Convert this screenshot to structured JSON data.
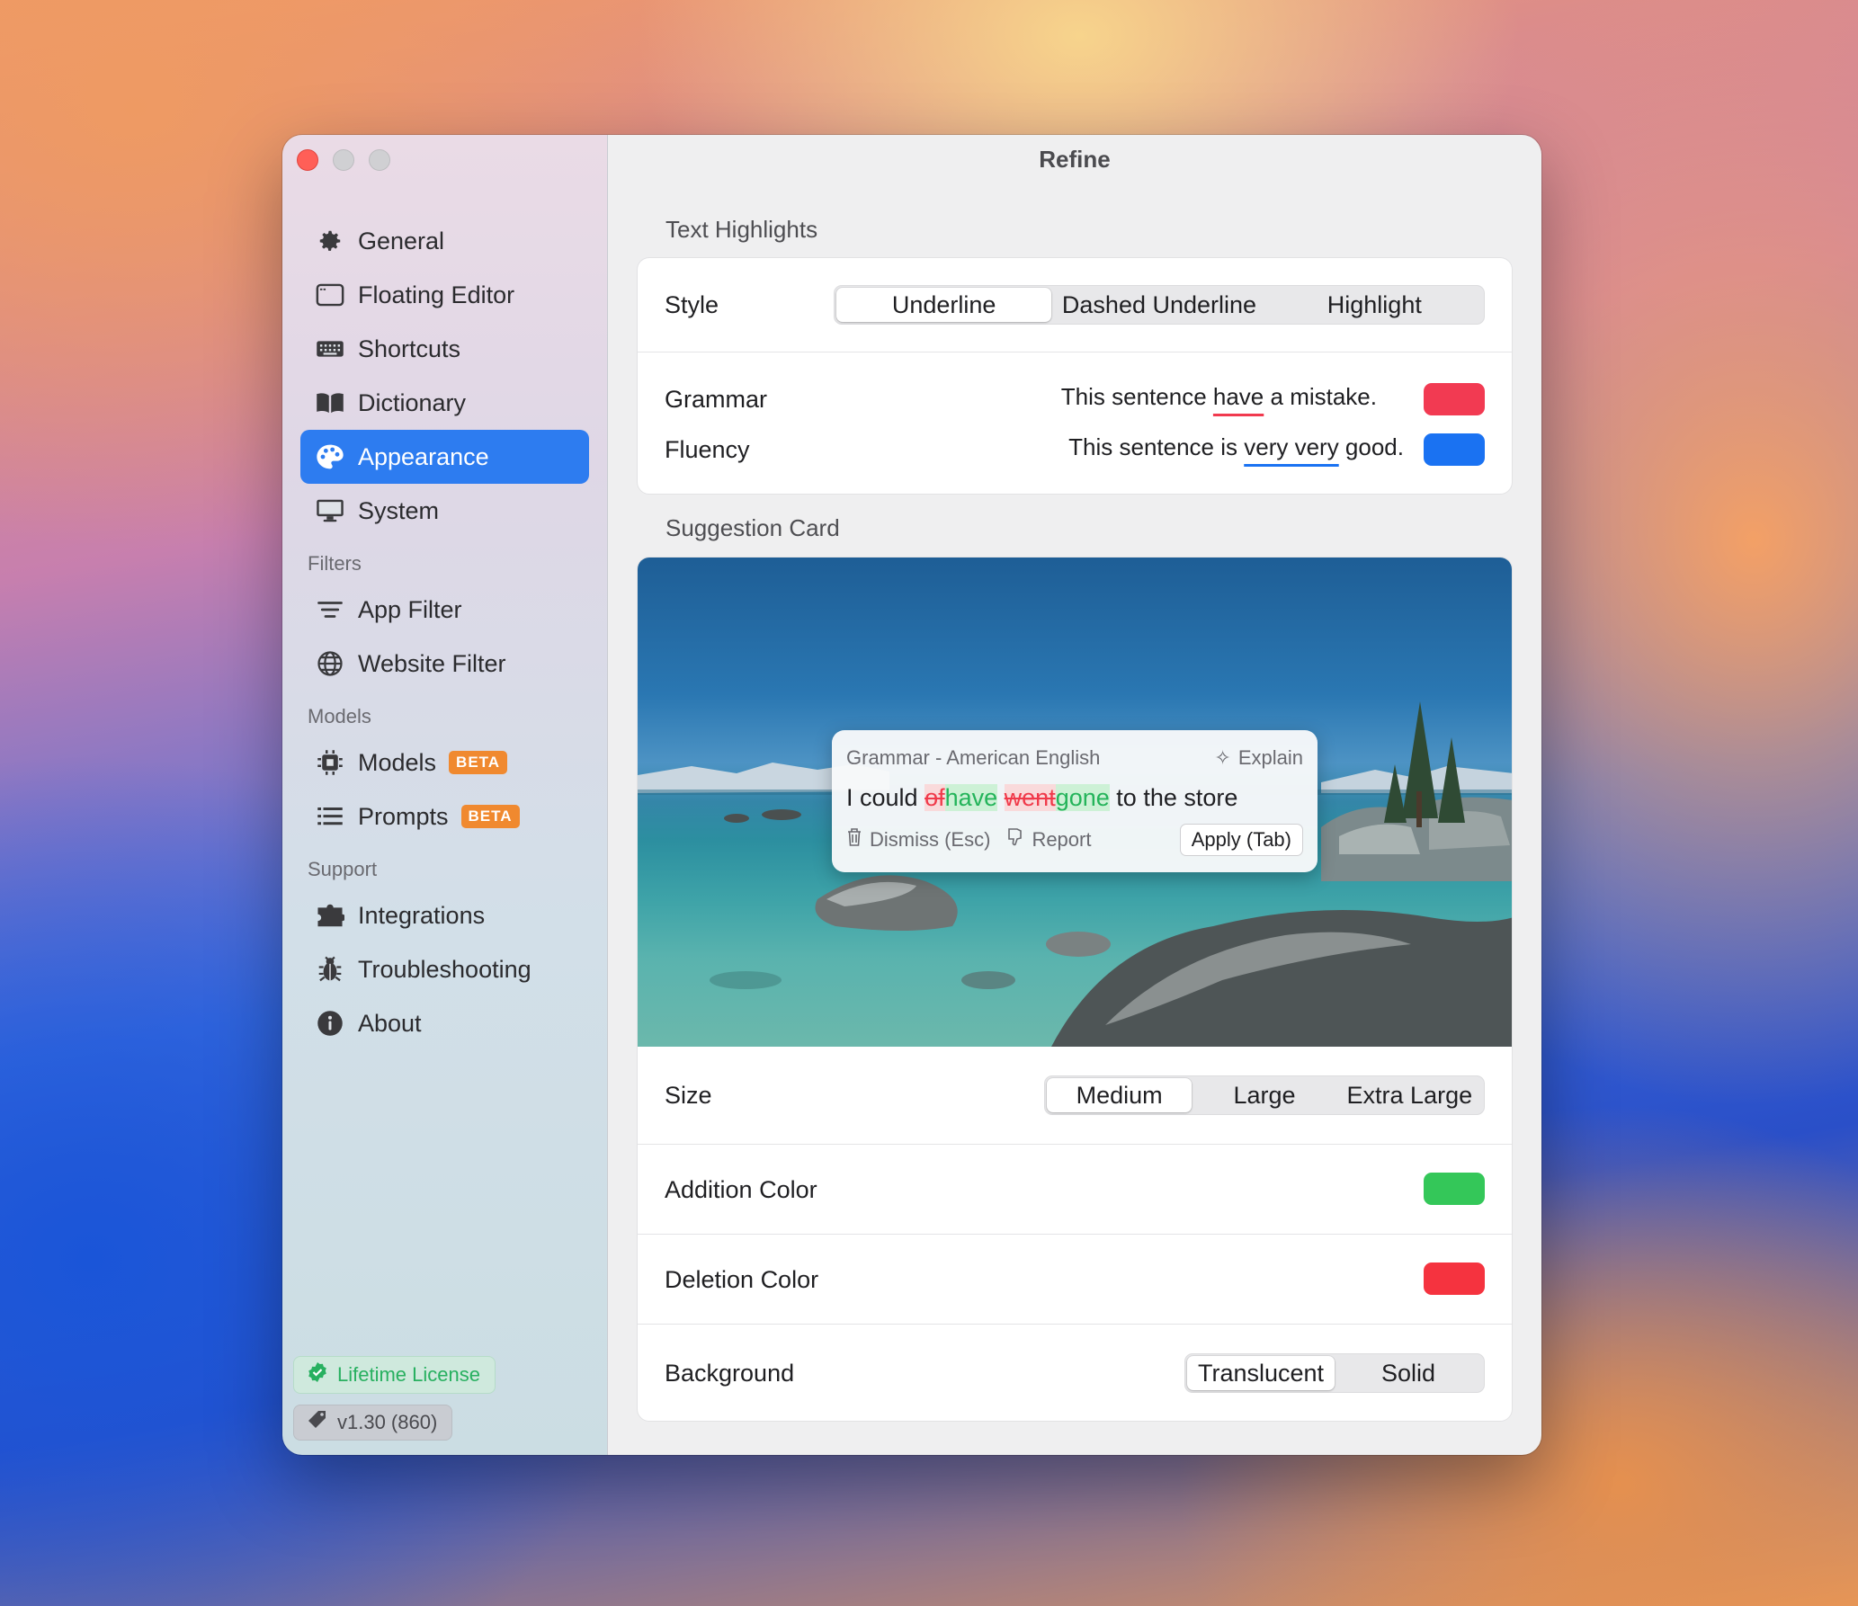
{
  "window": {
    "title": "Refine"
  },
  "sidebar": {
    "items": [
      {
        "label": "General",
        "icon": "gear-icon"
      },
      {
        "label": "Floating Editor",
        "icon": "window-icon"
      },
      {
        "label": "Shortcuts",
        "icon": "keyboard-icon"
      },
      {
        "label": "Dictionary",
        "icon": "book-icon"
      },
      {
        "label": "Appearance",
        "icon": "palette-icon",
        "active": true
      },
      {
        "label": "System",
        "icon": "monitor-icon"
      }
    ],
    "filters_heading": "Filters",
    "filters": [
      {
        "label": "App Filter",
        "icon": "filter-lines-icon"
      },
      {
        "label": "Website Filter",
        "icon": "globe-icon"
      }
    ],
    "models_heading": "Models",
    "models": [
      {
        "label": "Models",
        "icon": "chip-icon",
        "badge": "BETA"
      },
      {
        "label": "Prompts",
        "icon": "list-icon",
        "badge": "BETA"
      }
    ],
    "support_heading": "Support",
    "support": [
      {
        "label": "Integrations",
        "icon": "puzzle-icon"
      },
      {
        "label": "Troubleshooting",
        "icon": "bug-icon"
      },
      {
        "label": "About",
        "icon": "info-icon"
      }
    ],
    "license": "Lifetime License",
    "version": "v1.30 (860)"
  },
  "text_highlights": {
    "heading": "Text Highlights",
    "style_label": "Style",
    "style_options": [
      "Underline",
      "Dashed Underline",
      "Highlight"
    ],
    "style_selected": "Underline",
    "grammar_label": "Grammar",
    "grammar_sample": {
      "before": "This sentence ",
      "marked": "have",
      "after": " a mistake."
    },
    "grammar_color": "#f23a52",
    "fluency_label": "Fluency",
    "fluency_sample": {
      "before": "This sentence is ",
      "marked": "very very",
      "after": " good."
    },
    "fluency_color": "#1a72f2"
  },
  "suggestion_card": {
    "heading": "Suggestion Card",
    "preview": {
      "header": "Grammar - American English",
      "explain": "Explain",
      "text_start": "I could ",
      "del1": "of",
      "add1": "have",
      "del2": "went",
      "add2": "gone",
      "text_end": " to the store",
      "dismiss": "Dismiss (Esc)",
      "report": "Report",
      "apply": "Apply (Tab)"
    },
    "size_label": "Size",
    "size_options": [
      "Medium",
      "Large",
      "Extra Large"
    ],
    "size_selected": "Medium",
    "addition_label": "Addition Color",
    "addition_color": "#34c759",
    "deletion_label": "Deletion Color",
    "deletion_color": "#f5333f",
    "background_label": "Background",
    "background_options": [
      "Translucent",
      "Solid"
    ],
    "background_selected": "Translucent"
  }
}
